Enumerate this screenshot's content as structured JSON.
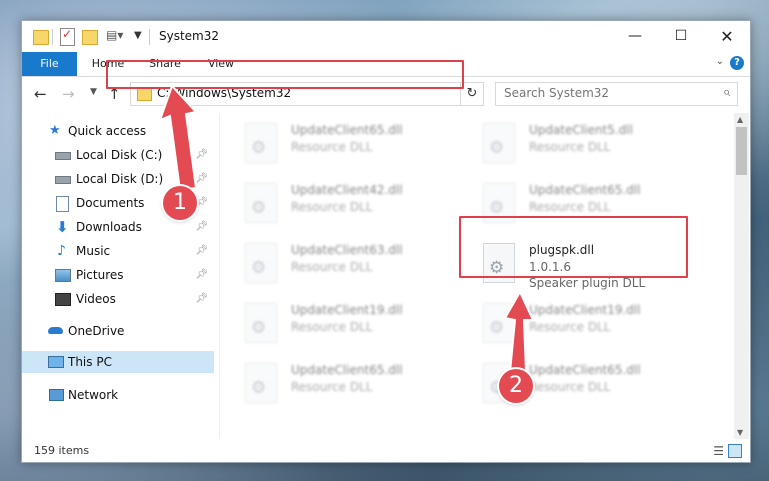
{
  "window": {
    "title": "System32",
    "controls": {
      "minimize": "—",
      "maximize": "☐",
      "close": "✕"
    }
  },
  "ribbon": {
    "tabs": [
      "File",
      "Home",
      "Share",
      "View"
    ],
    "expand_glyph": "⌄",
    "help_glyph": "?"
  },
  "navbar": {
    "address": "C:\\Windows\\System32",
    "search_placeholder": "Search System32"
  },
  "sidebar": {
    "items": [
      {
        "label": "Quick access",
        "icon": "star-icon",
        "pinned": false
      },
      {
        "label": "Local Disk (C:)",
        "icon": "drive-icon",
        "pinned": true
      },
      {
        "label": "Local Disk (D:)",
        "icon": "drive-icon",
        "pinned": true
      },
      {
        "label": "Documents",
        "icon": "documents-icon",
        "pinned": true
      },
      {
        "label": "Downloads",
        "icon": "download-icon",
        "pinned": true
      },
      {
        "label": "Music",
        "icon": "music-icon",
        "pinned": true
      },
      {
        "label": "Pictures",
        "icon": "pictures-icon",
        "pinned": true
      },
      {
        "label": "Videos",
        "icon": "videos-icon",
        "pinned": true
      },
      {
        "label": "OneDrive",
        "icon": "cloud-icon",
        "pinned": false
      },
      {
        "label": "This PC",
        "icon": "computer-icon",
        "pinned": false,
        "selected": true
      },
      {
        "label": "Network",
        "icon": "network-icon",
        "pinned": false
      }
    ]
  },
  "files": [
    {
      "name": "UpdateClient65.dll",
      "type": "Resource DLL"
    },
    {
      "name": "UpdateClient5.dll",
      "type": "Resource DLL"
    },
    {
      "name": "UpdateClient42.dll",
      "type": "Resource DLL"
    },
    {
      "name": "UpdateClient65.dll",
      "type": "Resource DLL"
    },
    {
      "name": "UpdateClient63.dll",
      "type": "Resource DLL"
    },
    {
      "name": "plugspk.dll",
      "version": "1.0.1.6",
      "type": "Speaker plugin DLL"
    },
    {
      "name": "UpdateClient19.dll",
      "type": "Resource DLL"
    },
    {
      "name": "UpdateClient19.dll",
      "type": "Resource DLL"
    },
    {
      "name": "UpdateClient65.dll",
      "type": "Resource DLL"
    },
    {
      "name": "UpdateClient65.dll",
      "type": "Resource DLL"
    }
  ],
  "status": {
    "count": "159 items"
  },
  "annotations": {
    "step1": "1",
    "step2": "2",
    "highlight_color": "#e0404a"
  }
}
